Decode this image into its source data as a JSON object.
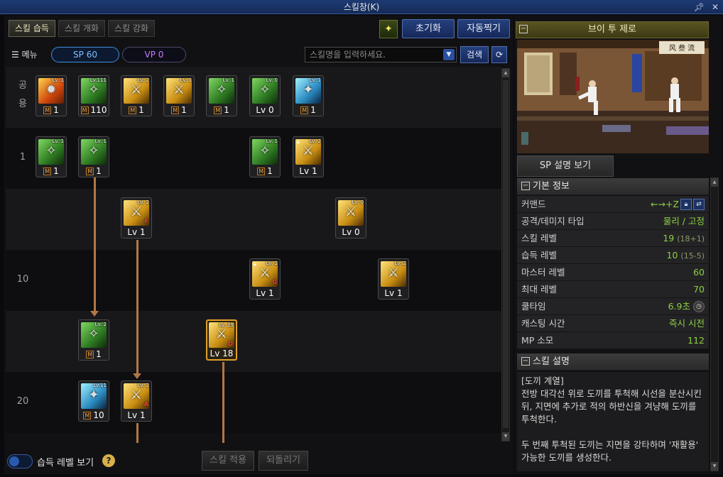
{
  "window": {
    "title": "스킬창(K)",
    "pin_icon": "pin-icon",
    "close_icon": "close-icon"
  },
  "tabs": [
    "스킬 습득",
    "스킬 개화",
    "스킬 강화"
  ],
  "top_buttons": {
    "reset": "초기화",
    "auto": "자동찍기"
  },
  "menubar": {
    "menu": "메뉴",
    "sp": "SP 60",
    "vp": "VP 0",
    "search_placeholder": "스킬명을 입력하세요.",
    "search_btn": "검색"
  },
  "row_labels": {
    "common": "공\n용",
    "r1": "1",
    "r10": "10",
    "r20": "20"
  },
  "skills": [
    {
      "lv": "Lv. 1",
      "foot": "1",
      "m": true,
      "theme": "fire"
    },
    {
      "lv": "Lv.111",
      "foot": "110",
      "m": true,
      "theme": "green"
    },
    {
      "lv": "Lv. 2",
      "foot": "1",
      "m": true,
      "theme": "gold"
    },
    {
      "lv": "Lv. 1",
      "foot": "1",
      "m": true,
      "theme": "gold"
    },
    {
      "lv": "Lv. 1",
      "foot": "1",
      "m": true,
      "theme": "green"
    },
    {
      "lv": "Lv. 0",
      "foot": "Lv 0",
      "m": false,
      "theme": "green"
    },
    {
      "lv": "Lv. 1",
      "foot": "1",
      "m": true,
      "theme": "blue"
    },
    {
      "lv": "Lv. 1",
      "foot": "1",
      "m": true,
      "theme": "green"
    },
    {
      "lv": "Lv. 1",
      "foot": "1",
      "m": true,
      "theme": "green"
    },
    {
      "lv": "Lv. 1",
      "foot": "1",
      "m": true,
      "theme": "green"
    },
    {
      "lv": "Lv. 2",
      "foot": "Lv 1",
      "m": false,
      "theme": "gold",
      "lock": true
    },
    {
      "lv": "Lv. 2",
      "foot": "Lv 1",
      "m": false,
      "theme": "gold",
      "rank": "F"
    },
    {
      "lv": "Lv. 0",
      "foot": "Lv 0",
      "m": false,
      "theme": "gold"
    },
    {
      "lv": "Lv. 2",
      "foot": "Lv 1",
      "m": false,
      "theme": "gold",
      "rank": "G",
      "lock": true
    },
    {
      "lv": "Lv. 2",
      "foot": "Lv 1",
      "m": false,
      "theme": "gold"
    },
    {
      "lv": "Lv. 2",
      "foot": "1",
      "m": true,
      "theme": "green"
    },
    {
      "lv": "Lv. 19",
      "foot": "Lv 18",
      "m": false,
      "theme": "gold",
      "rank": "D",
      "selected": true
    },
    {
      "lv": "Lv.11",
      "foot": "10",
      "m": true,
      "theme": "blue"
    },
    {
      "lv": "Lv. 2",
      "foot": "Lv 1",
      "m": false,
      "theme": "gold",
      "rank": "A"
    }
  ],
  "bottom": {
    "toggle_label": "습득 레벨 보기",
    "help": "?",
    "apply": "스킬 적용",
    "revert": "되돌리기"
  },
  "detail": {
    "name": "브이 투 제로",
    "preview_sign": "风 叁 流",
    "sp_button": "SP 설명 보기",
    "basic_info_title": "기본 정보",
    "rows": [
      {
        "k": "커맨드",
        "v": "←→+Z"
      },
      {
        "k": "공격/데미지 타입",
        "v": "물리 / 고정"
      },
      {
        "k": "스킬 레벨",
        "v": "19",
        "sub": "(18+1)"
      },
      {
        "k": "습득 레벨",
        "v": "10",
        "sub": "(15-5)"
      },
      {
        "k": "마스터 레벨",
        "v": "60"
      },
      {
        "k": "최대 레벨",
        "v": "70"
      },
      {
        "k": "쿨타임",
        "v": "6.9초"
      },
      {
        "k": "캐스팅 시간",
        "v": "즉시 시전"
      },
      {
        "k": "MP 소모",
        "v": "112"
      }
    ],
    "desc_title": "스킬 설명",
    "desc_lines": [
      "[도끼 계열]",
      "전방 대각선 위로 도끼를 투척해 시선을 분산시킨 뒤, 지면에 추가로 적의 하반신을 겨냥해 도끼를 투척한다.",
      "두 번째 투척된 도끼는 지면을 강타하며 '재활용' 가능한 도끼를 생성한다."
    ]
  },
  "colors": {
    "accent_blue": "#3d8fe0",
    "value_green": "#8ed040",
    "selected_border": "#e0a02a"
  }
}
